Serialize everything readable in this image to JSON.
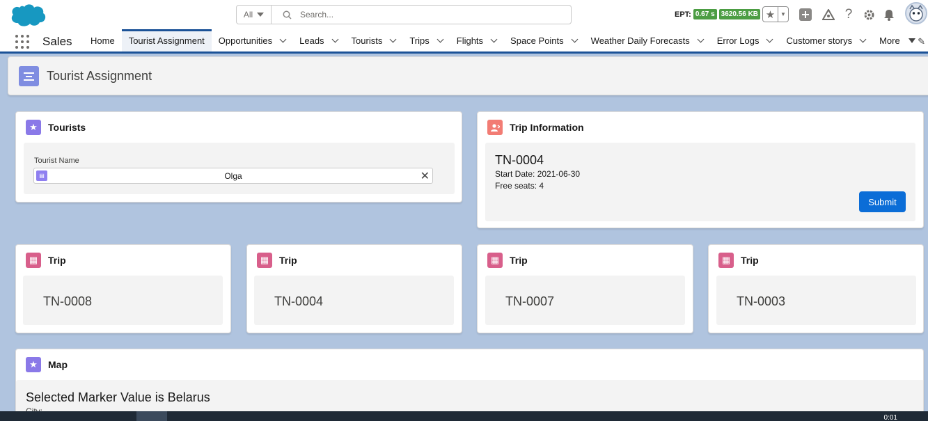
{
  "header": {
    "search_scope": "All",
    "search_placeholder": "Search...",
    "ept_label": "EPT:",
    "ept_time": "0.67 s",
    "ept_size": "3620.56 KB"
  },
  "nav": {
    "app_name": "Sales",
    "items": [
      {
        "label": "Home"
      },
      {
        "label": "Tourist Assignment"
      },
      {
        "label": "Opportunities"
      },
      {
        "label": "Leads"
      },
      {
        "label": "Tourists"
      },
      {
        "label": "Trips"
      },
      {
        "label": "Flights"
      },
      {
        "label": "Space Points"
      },
      {
        "label": "Weather Daily Forecasts"
      },
      {
        "label": "Error Logs"
      },
      {
        "label": "Customer storys"
      },
      {
        "label": "More"
      }
    ]
  },
  "page": {
    "title": "Tourist Assignment"
  },
  "tourists_card": {
    "title": "Tourists",
    "field_label": "Tourist Name",
    "field_value": "Olga"
  },
  "trip_info_card": {
    "title": "Trip Information",
    "trip_id": "TN-0004",
    "start_date": "Start Date: 2021-06-30",
    "free_seats": "Free seats: 4",
    "submit_label": "Submit"
  },
  "trip_cards": [
    {
      "title": "Trip",
      "number": "TN-0008"
    },
    {
      "title": "Trip",
      "number": "TN-0004"
    },
    {
      "title": "Trip",
      "number": "TN-0007"
    },
    {
      "title": "Trip",
      "number": "TN-0003"
    }
  ],
  "map_card": {
    "title": "Map",
    "selected_text": "Selected Marker Value is Belarus",
    "sub_text": "City:"
  },
  "taskbar": {
    "clock": "0:01"
  },
  "colors": {
    "brand_blue": "#0b6dd7",
    "nav_accent": "#1b5297",
    "background": "#b0c4df",
    "star_icon": "#8a79e8",
    "contact_icon": "#f27c74",
    "trip_icon": "#d85f8b"
  }
}
